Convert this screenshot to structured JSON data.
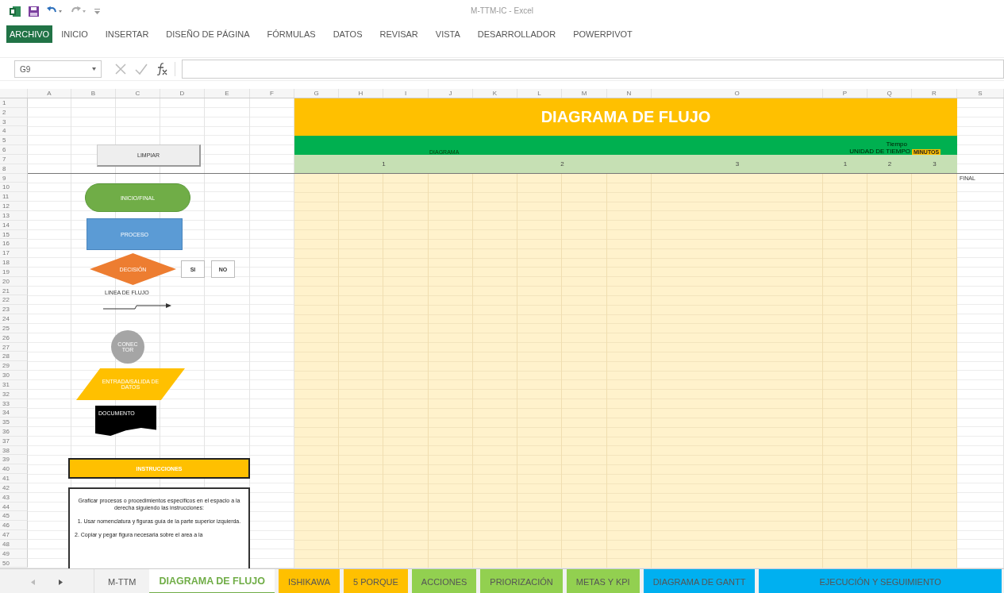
{
  "window": {
    "title": "M-TTM-IC - Excel"
  },
  "ribbon_tabs": [
    {
      "label": "ARCHIVO",
      "kind": "file"
    },
    {
      "label": "INICIO",
      "kind": "tab"
    },
    {
      "label": "INSERTAR",
      "kind": "tab"
    },
    {
      "label": "DISEÑO DE PÁGINA",
      "kind": "tab"
    },
    {
      "label": "FÓRMULAS",
      "kind": "tab"
    },
    {
      "label": "DATOS",
      "kind": "tab"
    },
    {
      "label": "REVISAR",
      "kind": "tab"
    },
    {
      "label": "VISTA",
      "kind": "tab"
    },
    {
      "label": "DESARROLLADOR",
      "kind": "tab"
    },
    {
      "label": "POWERPIVOT",
      "kind": "tab"
    }
  ],
  "formula_bar": {
    "name_box": "G9"
  },
  "columns": [
    "A",
    "B",
    "C",
    "D",
    "E",
    "F",
    "G",
    "H",
    "I",
    "J",
    "K",
    "L",
    "M",
    "N",
    "O",
    "P",
    "Q",
    "R",
    "S"
  ],
  "row_count_label": [
    "1",
    "2",
    "3",
    "4",
    "5",
    "6",
    "7",
    "8",
    "9",
    "10",
    "11",
    "12",
    "13",
    "14",
    "15",
    "16",
    "17",
    "18",
    "19",
    "20",
    "21",
    "22",
    "23",
    "24",
    "25",
    "26",
    "27",
    "28",
    "29",
    "30",
    "31",
    "32",
    "33",
    "34",
    "35",
    "36",
    "37",
    "38",
    "39",
    "40",
    "41",
    "42",
    "43",
    "44",
    "45",
    "46",
    "47",
    "48",
    "49",
    "50"
  ],
  "header": {
    "title": "DIAGRAMA DE FLUJO",
    "diagram_label": "DIAGRAMA",
    "time_label": "Tiempo",
    "time_unit_label": "UNIDAD DE TIEMPO",
    "time_unit": "MINUTOS",
    "diagram_columns": [
      "1",
      "2",
      "3"
    ],
    "time_columns": [
      "1",
      "2",
      "3"
    ]
  },
  "final_cell": "FINAL",
  "clear_button": "LIMPIAR",
  "shapes": [
    {
      "kind": "terminator",
      "label": "INICIO/FINAL"
    },
    {
      "kind": "process",
      "label": "PROCESO"
    },
    {
      "kind": "decision",
      "label": "DECISIÓN"
    },
    {
      "kind": "connector",
      "label": "CONEC TOR"
    },
    {
      "kind": "data",
      "label": "ENTRADA/SALIDA DE DATOS"
    },
    {
      "kind": "document",
      "label": "DOCUMENTO"
    }
  ],
  "decision_answers": [
    "SI",
    "NO"
  ],
  "flow_line_label": "LINEA DE FLUJO",
  "instructions": {
    "title": "INSTRUCCIONES",
    "paragraphs": [
      "Graficar procesos o procedimientos específicos en el espacio a la derecha siguiendo las instrucciones:",
      "1. Usar nomenclatura y figuras guía de la parte superior izquierda.",
      "2. Copiar y pegar figura necesaria sobre el area a la"
    ]
  },
  "sheet_tabs": [
    {
      "label": "M-TTM",
      "selected": false
    },
    {
      "label": "DIAGRAMA DE FLUJO",
      "selected": true,
      "color": "#70ad47"
    },
    {
      "label": "ISHIKAWA",
      "selected": false,
      "color": "#ffc000"
    },
    {
      "label": "5 PORQUE",
      "selected": false,
      "color": "#ffc000"
    },
    {
      "label": "ACCIONES",
      "selected": false,
      "color": "#92d050"
    },
    {
      "label": "PRIORIZACIÓN",
      "selected": false,
      "color": "#92d050"
    },
    {
      "label": "METAS Y KPI",
      "selected": false,
      "color": "#92d050"
    },
    {
      "label": "DIAGRAMA DE GANTT",
      "selected": false,
      "color": "#00b0f0"
    },
    {
      "label": "EJECUCIÓN Y SEGUIMIENTO",
      "selected": false,
      "color": "#00b0f0"
    }
  ]
}
